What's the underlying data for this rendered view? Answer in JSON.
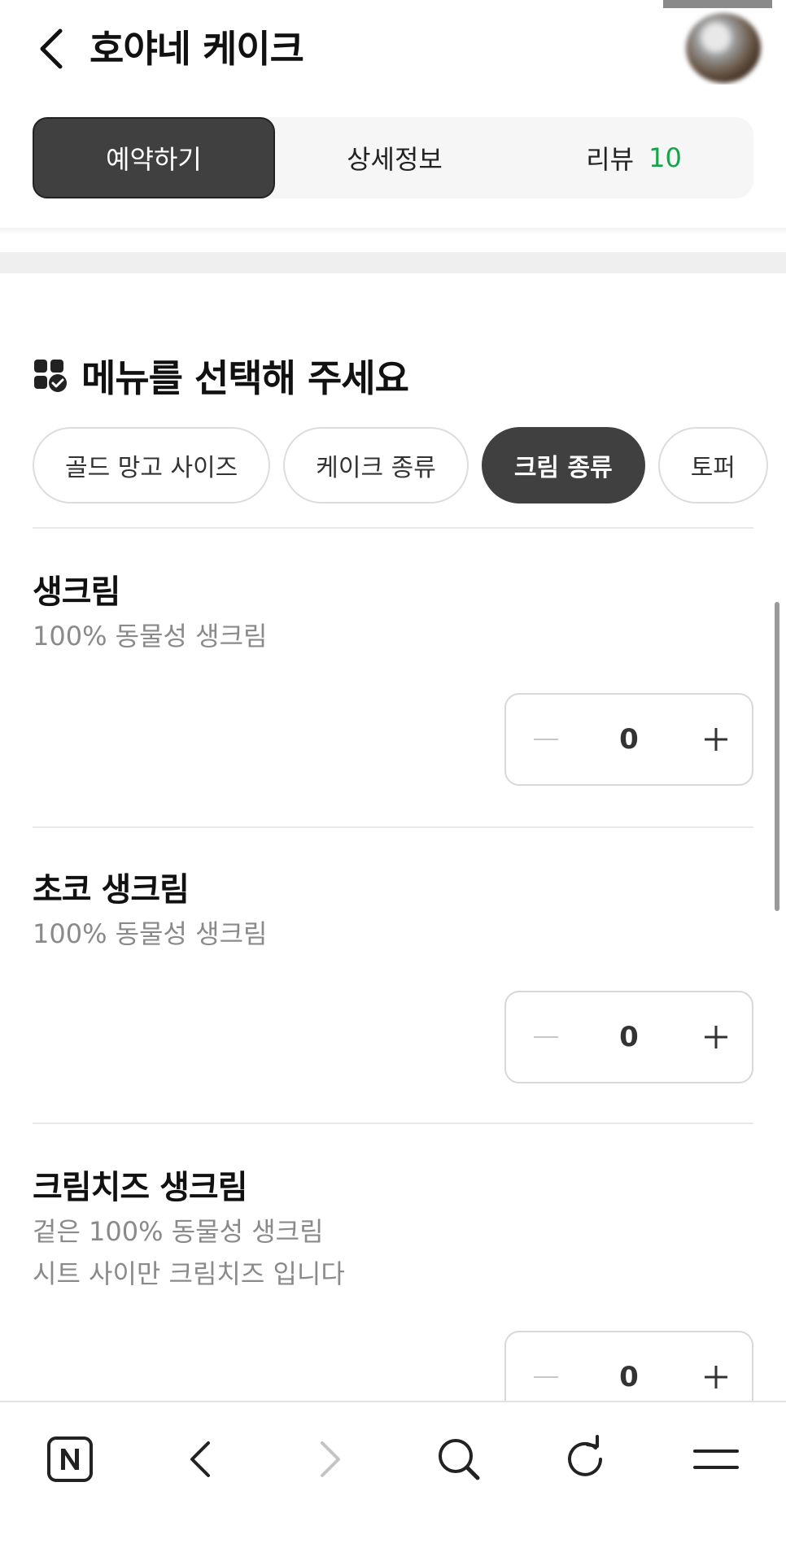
{
  "header": {
    "title": "호야네 케이크"
  },
  "tabs": [
    {
      "label": "예약하기",
      "active": true
    },
    {
      "label": "상세정보",
      "active": false
    },
    {
      "label": "리뷰",
      "count": "10",
      "active": false
    }
  ],
  "section": {
    "title": "메뉴를 선택해 주세요"
  },
  "categories": [
    {
      "label": "골드 망고 사이즈",
      "active": false
    },
    {
      "label": "케이크 종류",
      "active": false
    },
    {
      "label": "크림 종류",
      "active": true
    },
    {
      "label": "토퍼",
      "active": false
    }
  ],
  "menu_items": [
    {
      "name": "생크림",
      "description_lines": [
        "100% 동물성 생크림"
      ],
      "quantity": "0"
    },
    {
      "name": "초코 생크림",
      "description_lines": [
        "100% 동물성 생크림"
      ],
      "quantity": "0"
    },
    {
      "name": "크림치즈 생크림",
      "description_lines": [
        "겉은 100% 동물성 생크림",
        "시트 사이만 크림치즈 입니다"
      ],
      "quantity": "0"
    }
  ],
  "colors": {
    "accent_dark": "#404040",
    "review_count": "#17a34a"
  },
  "bottom_nav": {
    "icons": [
      "naver-home-icon",
      "back-arrow-icon",
      "forward-arrow-icon",
      "search-icon",
      "refresh-icon",
      "menu-icon"
    ],
    "forward_enabled": false
  }
}
